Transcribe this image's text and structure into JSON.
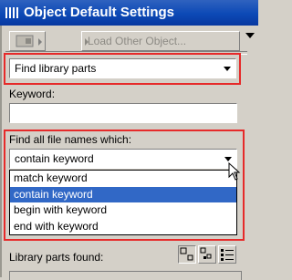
{
  "window": {
    "title": "Object Default Settings"
  },
  "toolbar": {
    "load_other_label": "Load Other Object..."
  },
  "mode_select": {
    "value": "Find library parts"
  },
  "keyword": {
    "label": "Keyword:",
    "value": ""
  },
  "filename_filter": {
    "label": "Find all file names which:",
    "value": "contain keyword",
    "options": [
      "match keyword",
      "contain keyword",
      "begin with keyword",
      "end with keyword"
    ],
    "selected_index": 1
  },
  "results": {
    "label": "Library parts found:"
  },
  "icons": [
    "app-icon",
    "object-preview-icon",
    "panel-menu-arrow-icon",
    "large-icons-view-icon",
    "small-icons-view-icon",
    "list-view-icon",
    "mouse-cursor-icon"
  ]
}
